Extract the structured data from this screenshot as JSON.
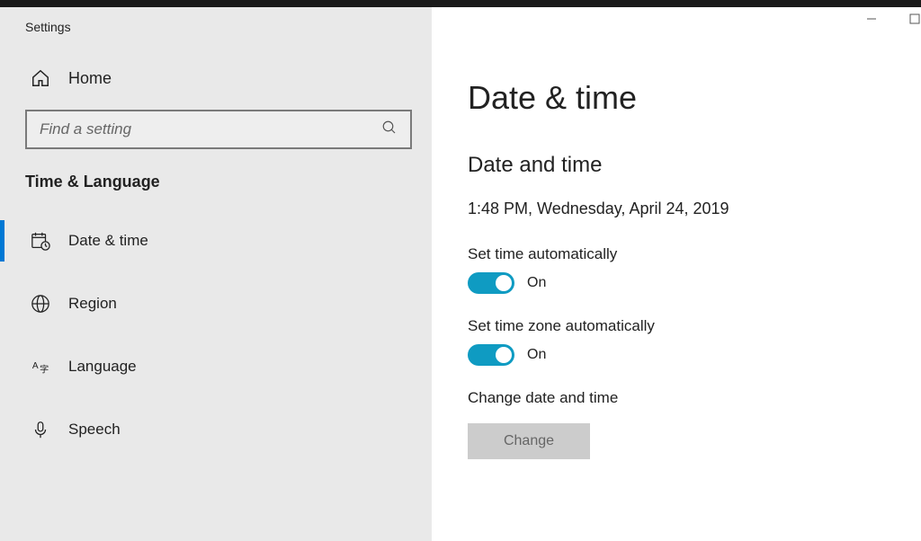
{
  "window": {
    "title": "Settings"
  },
  "sidebar": {
    "home_label": "Home",
    "search_placeholder": "Find a setting",
    "section_label": "Time & Language",
    "items": [
      {
        "label": "Date & time"
      },
      {
        "label": "Region"
      },
      {
        "label": "Language"
      },
      {
        "label": "Speech"
      }
    ]
  },
  "main": {
    "title": "Date & time",
    "subsection": "Date and time",
    "current_datetime": "1:48 PM, Wednesday, April 24, 2019",
    "settings": {
      "auto_time_label": "Set time automatically",
      "auto_time_state": "On",
      "auto_tz_label": "Set time zone automatically",
      "auto_tz_state": "On",
      "change_label": "Change date and time",
      "change_button": "Change"
    }
  }
}
